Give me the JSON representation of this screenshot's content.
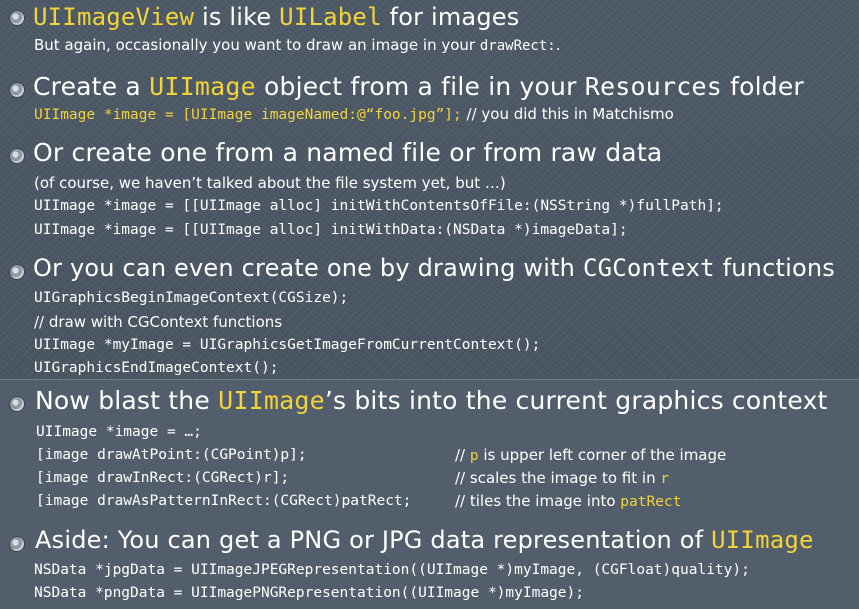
{
  "b1": {
    "title_a": "UIImageView",
    "title_b": " is like ",
    "title_c": "UILabel",
    "title_d": " for images",
    "sub_a": "But again, occasionally you want to draw an image in your ",
    "sub_b": "drawRect:",
    "sub_c": "."
  },
  "b2": {
    "title_a": "Create a ",
    "title_b": "UIImage",
    "title_c": " object from a file in your ",
    "title_d": "Resources",
    "title_e": " folder",
    "code": "UIImage *image = [UIImage imageNamed:@“foo.jpg”];",
    "comment": " // you did this in Matchismo"
  },
  "b3": {
    "title": "Or create one from a named file or from raw data",
    "note": "(of course, we haven’t talked about the file system yet, but …)",
    "code1": "UIImage *image = [[UIImage alloc] initWithContentsOfFile:(NSString *)fullPath];",
    "code2": "UIImage *image = [[UIImage alloc] initWithData:(NSData *)imageData];"
  },
  "b4": {
    "title_a": "Or you can even create one by drawing with ",
    "title_b": "CGContext",
    "title_c": " functions",
    "code1": "UIGraphicsBeginImageContext(CGSize);",
    "comment": "// draw with CGContext functions",
    "code2": "UIImage *myImage = UIGraphicsGetImageFromCurrentContext();",
    "code3": "UIGraphicsEndImageContext();"
  },
  "b5": {
    "title_a": "Now blast the ",
    "title_b": "UIImage",
    "title_c": "’s bits into the current graphics context",
    "code0": "UIImage *image = …;",
    "rows": [
      {
        "code": "[image drawAtPoint:(CGPoint)p];",
        "c1": "// ",
        "c2": "p",
        "c3": " is upper left corner of the image"
      },
      {
        "code": "[image drawInRect:(CGRect)r];",
        "c1": "// scales the image to fit in ",
        "c2": "r",
        "c3": ""
      },
      {
        "code": "[image drawAsPatternInRect:(CGRect)patRect;",
        "c1": "// tiles the image into ",
        "c2": "patRect",
        "c3": ""
      }
    ]
  },
  "b6": {
    "title_a": "Aside: You can get a PNG or JPG data representation of ",
    "title_b": "UIImage",
    "code1": "NSData *jpgData = UIImageJPEGRepresentation((UIImage *)myImage, (CGFloat)quality);",
    "code2": "NSData *pngData = UIImagePNGRepresentation((UIImage *)myImage);"
  },
  "colors": {
    "background": "#4a5663",
    "code": "#f2d33a",
    "text": "#ffffff"
  },
  "icons": {
    "bullet": "bullet-icon"
  }
}
